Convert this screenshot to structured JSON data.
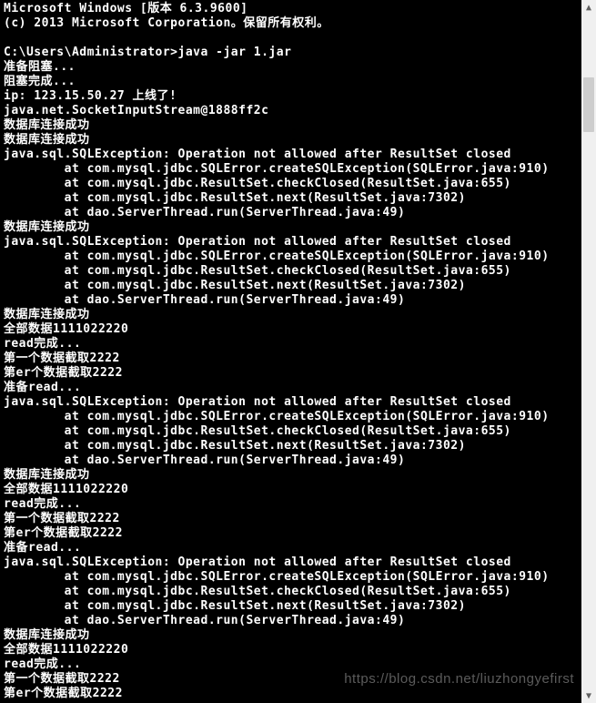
{
  "console": {
    "lines": [
      "Microsoft Windows [版本 6.3.9600]",
      "(c) 2013 Microsoft Corporation。保留所有权利。",
      "",
      "C:\\Users\\Administrator>java -jar 1.jar",
      "准备阻塞...",
      "阻塞完成...",
      "ip: 123.15.50.27 上线了!",
      "java.net.SocketInputStream@1888ff2c",
      "数据库连接成功",
      "数据库连接成功",
      "java.sql.SQLException: Operation not allowed after ResultSet closed",
      "        at com.mysql.jdbc.SQLError.createSQLException(SQLError.java:910)",
      "        at com.mysql.jdbc.ResultSet.checkClosed(ResultSet.java:655)",
      "        at com.mysql.jdbc.ResultSet.next(ResultSet.java:7302)",
      "        at dao.ServerThread.run(ServerThread.java:49)",
      "数据库连接成功",
      "java.sql.SQLException: Operation not allowed after ResultSet closed",
      "        at com.mysql.jdbc.SQLError.createSQLException(SQLError.java:910)",
      "        at com.mysql.jdbc.ResultSet.checkClosed(ResultSet.java:655)",
      "        at com.mysql.jdbc.ResultSet.next(ResultSet.java:7302)",
      "        at dao.ServerThread.run(ServerThread.java:49)",
      "数据库连接成功",
      "全部数据1111022220",
      "read完成...",
      "第一个数据截取2222",
      "第er个数据截取2222",
      "准备read...",
      "java.sql.SQLException: Operation not allowed after ResultSet closed",
      "        at com.mysql.jdbc.SQLError.createSQLException(SQLError.java:910)",
      "        at com.mysql.jdbc.ResultSet.checkClosed(ResultSet.java:655)",
      "        at com.mysql.jdbc.ResultSet.next(ResultSet.java:7302)",
      "        at dao.ServerThread.run(ServerThread.java:49)",
      "数据库连接成功",
      "全部数据1111022220",
      "read完成...",
      "第一个数据截取2222",
      "第er个数据截取2222",
      "准备read...",
      "java.sql.SQLException: Operation not allowed after ResultSet closed",
      "        at com.mysql.jdbc.SQLError.createSQLException(SQLError.java:910)",
      "        at com.mysql.jdbc.ResultSet.checkClosed(ResultSet.java:655)",
      "        at com.mysql.jdbc.ResultSet.next(ResultSet.java:7302)",
      "        at dao.ServerThread.run(ServerThread.java:49)",
      "数据库连接成功",
      "全部数据1111022220",
      "read完成...",
      "第一个数据截取2222",
      "第er个数据截取2222"
    ]
  },
  "scrollbar": {
    "up_glyph": "▲",
    "down_glyph": "▼"
  },
  "watermark": "https://blog.csdn.net/liuzhongyefirst"
}
